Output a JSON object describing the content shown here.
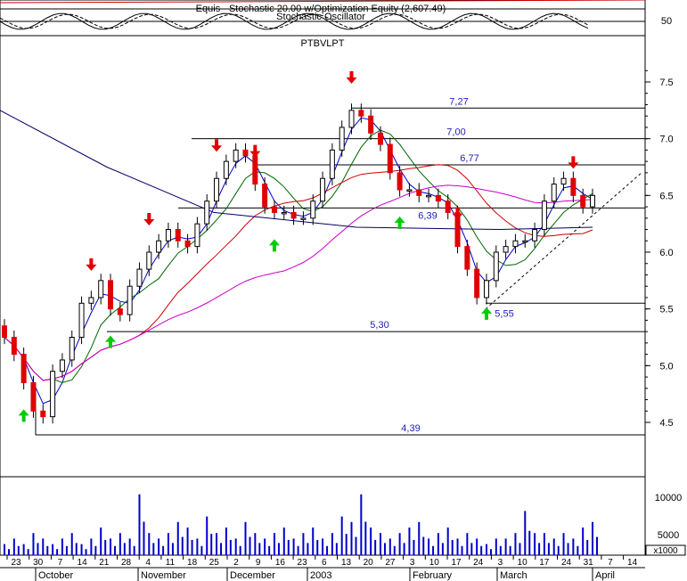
{
  "indicator_panel": {
    "title_line1": "Equis - Stochastic 20.00  w/Optimization Equity (2,607.49)",
    "title_line2": "Stochastic Oscillator",
    "scale_label": "50"
  },
  "price_panel": {
    "symbol": "PTBVLPT",
    "y_ticks": [
      "7.5",
      "7.0",
      "6.5",
      "6.0",
      "5.5",
      "5.0",
      "4.5"
    ],
    "levels": [
      "7,27",
      "7,00",
      "6,77",
      "6,39",
      "5,55",
      "5,30",
      "4,39"
    ]
  },
  "volume_panel": {
    "y_ticks": [
      "10000",
      "5000"
    ],
    "unit_label": "x1000"
  },
  "x_axis": {
    "day_ticks": [
      "23",
      "30",
      "7",
      "14",
      "21",
      "28",
      "4",
      "11",
      "18",
      "25",
      "2",
      "9",
      "16",
      "23",
      "6",
      "13",
      "20",
      "27",
      "3",
      "10",
      "17",
      "24",
      "3",
      "10",
      "17",
      "24",
      "31",
      "7",
      "14"
    ],
    "month_labels": [
      "October",
      "November",
      "December",
      "2003",
      "February",
      "March",
      "April"
    ]
  },
  "chart_data": {
    "type": "candlestick",
    "title": "PTBVLPT",
    "ylim": [
      4.3,
      7.8
    ],
    "horizontal_levels": [
      7.27,
      7.0,
      6.77,
      6.39,
      5.55,
      5.3,
      4.39
    ],
    "buy_signals": [
      "Oct 18",
      "Nov 21",
      "Dec 11",
      "Jan 29",
      "Feb 25"
    ],
    "sell_signals": [
      "Nov 14",
      "Nov 28",
      "Nov 28",
      "Dec 4",
      "Dec 21",
      "Jan 21",
      "Feb 19",
      "Mar 24"
    ],
    "series": [
      {
        "name": "close",
        "values": [
          5.25,
          5.1,
          4.85,
          4.6,
          4.55,
          4.95,
          5.05,
          5.25,
          5.55,
          5.6,
          5.75,
          5.5,
          5.45,
          5.7,
          5.85,
          6.0,
          6.1,
          6.2,
          6.1,
          6.05,
          6.25,
          6.45,
          6.65,
          6.8,
          6.9,
          6.85,
          6.6,
          6.4,
          6.35,
          6.35,
          6.3,
          6.3,
          6.45,
          6.65,
          6.9,
          7.1,
          7.25,
          7.2,
          7.05,
          6.95,
          6.7,
          6.55,
          6.55,
          6.5,
          6.5,
          6.45,
          6.35,
          6.05,
          5.85,
          5.6,
          5.75,
          6.0,
          6.05,
          6.1,
          6.1,
          6.2,
          6.45,
          6.6,
          6.65,
          6.5,
          6.4,
          6.5
        ]
      }
    ],
    "volume": [
      2,
      3,
      2,
      4,
      3,
      2,
      3,
      4,
      2,
      3,
      5,
      3,
      4,
      3,
      11,
      4,
      3,
      4,
      6,
      5,
      3,
      7,
      4,
      5,
      3,
      6,
      4,
      3,
      4,
      5,
      3,
      4,
      5,
      3,
      4,
      7,
      6,
      11,
      5,
      4,
      3,
      4,
      5,
      6,
      3,
      4,
      5,
      3,
      4,
      3,
      2,
      3,
      3,
      4,
      8,
      4,
      4,
      3,
      4,
      3,
      5,
      6
    ]
  }
}
